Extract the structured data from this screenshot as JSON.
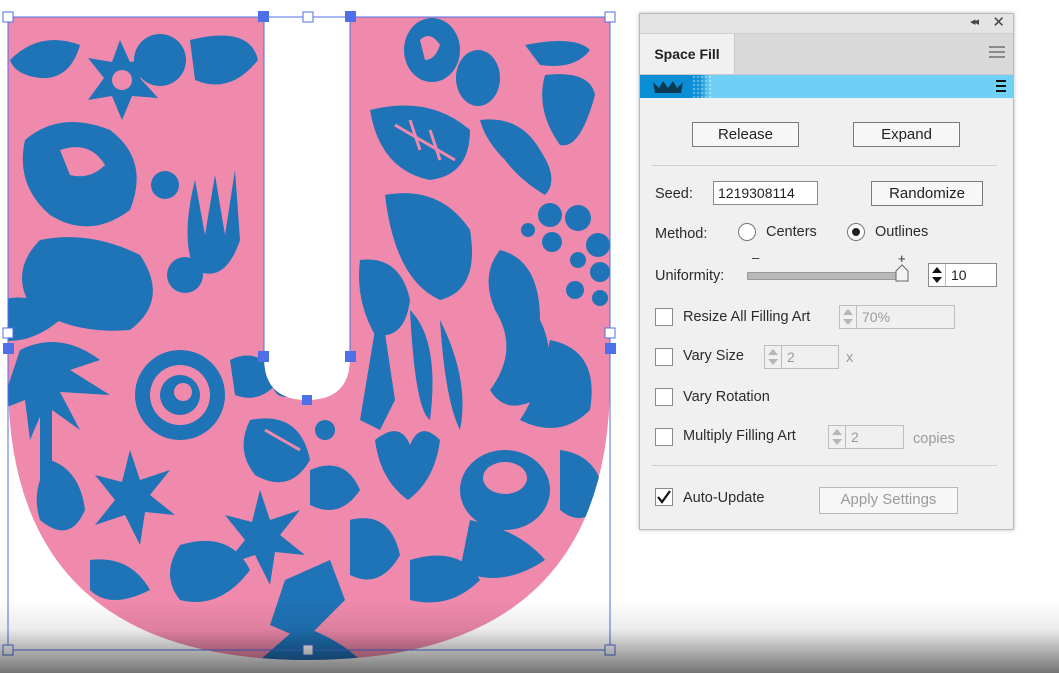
{
  "colors": {
    "shape_fill": "#f08aad",
    "art_color": "#1f73b7",
    "selection": "#4d6fe8",
    "panel_bg": "#f0f0f0",
    "strip_blue": "#6fcff5"
  },
  "panel": {
    "tab_label": "Space Fill",
    "collapse_icon": "double-chevron-left-icon",
    "close_icon": "close-icon",
    "brand_icon": "crown-icon",
    "buttons": {
      "release": "Release",
      "expand": "Expand",
      "randomize": "Randomize",
      "apply": "Apply Settings"
    },
    "seed": {
      "label": "Seed:",
      "value": "1219308114"
    },
    "method": {
      "label": "Method:",
      "options": [
        "Centers",
        "Outlines"
      ],
      "selected": "Outlines"
    },
    "uniformity": {
      "label": "Uniformity:",
      "minus": "–",
      "plus": "+",
      "value": "10",
      "slider_fraction": 1.0
    },
    "resize": {
      "label": "Resize All Filling Art",
      "value": "70%",
      "checked": false
    },
    "vary_size": {
      "label": "Vary Size",
      "value": "2",
      "suffix": "x",
      "checked": false
    },
    "vary_rotation": {
      "label": "Vary Rotation",
      "checked": false
    },
    "multiply": {
      "label": "Multiply Filling Art",
      "value": "2",
      "suffix": "copies",
      "checked": false
    },
    "auto_update": {
      "label": "Auto-Update",
      "checked": true
    }
  }
}
